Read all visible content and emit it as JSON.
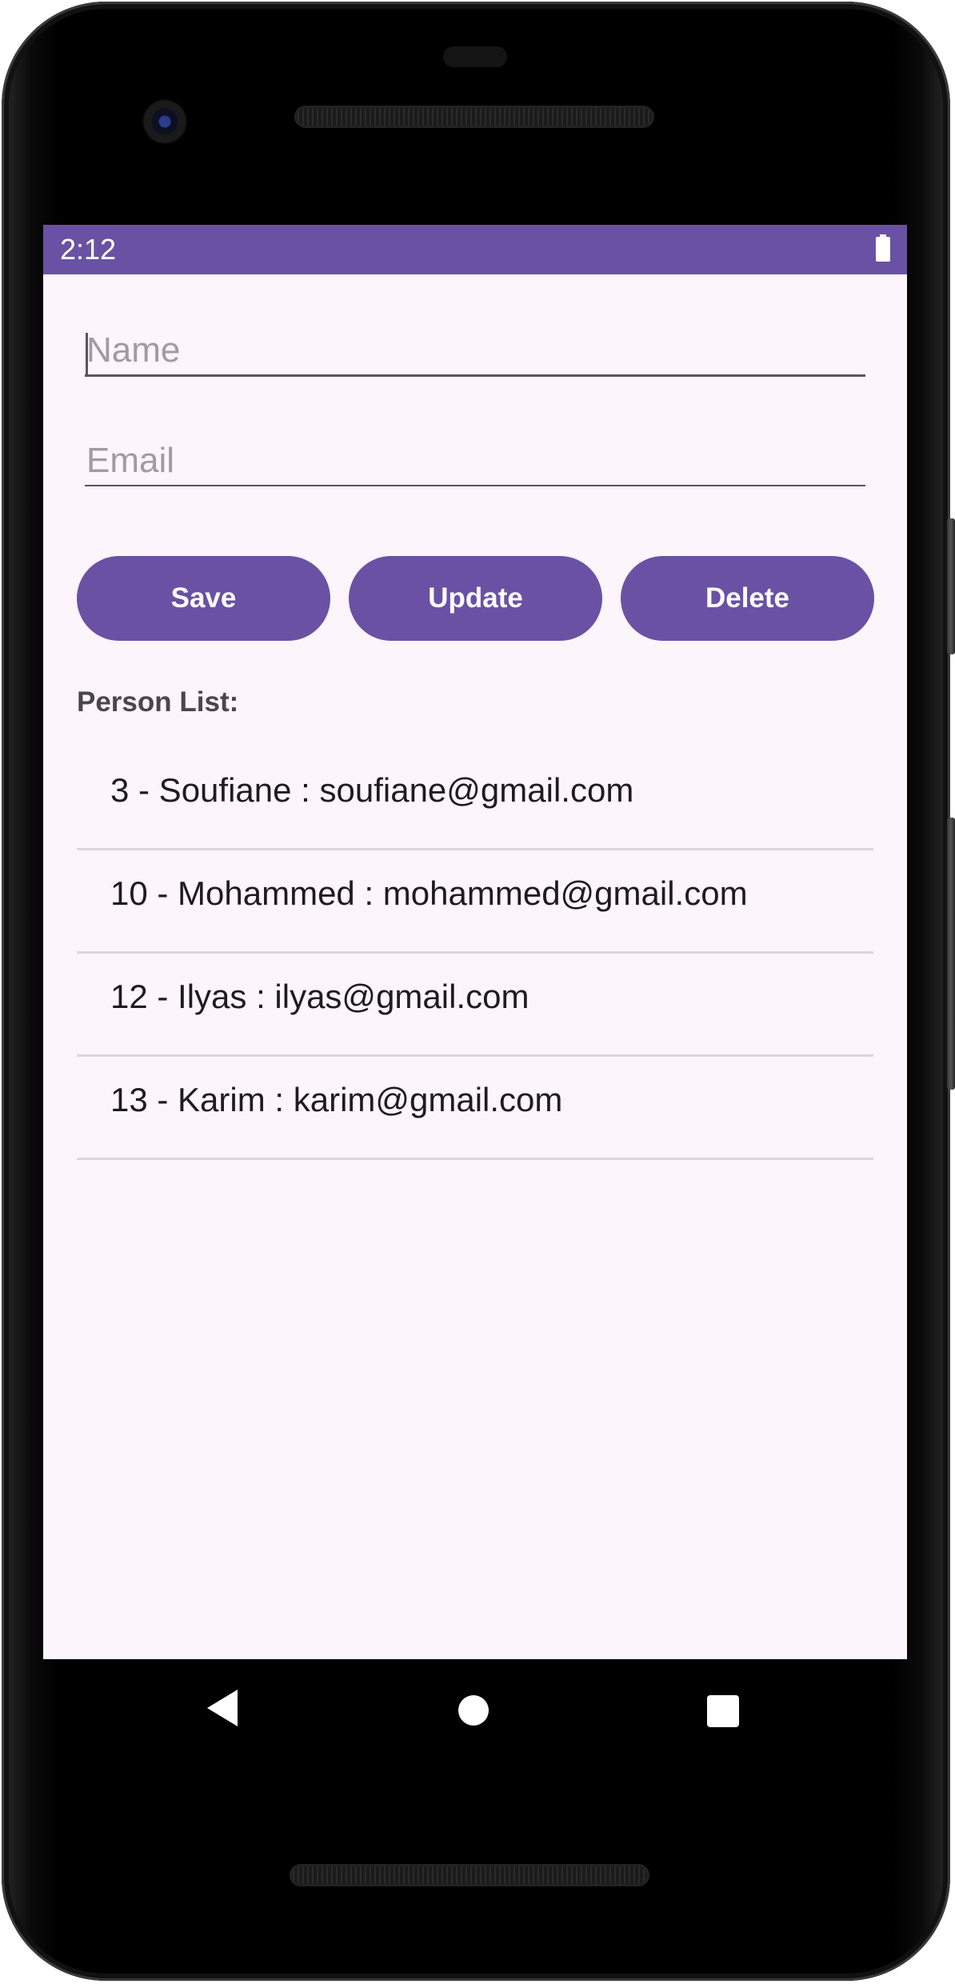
{
  "status_bar": {
    "time": "2:12",
    "battery_icon": "battery-full-icon"
  },
  "form": {
    "name_placeholder": "Name",
    "name_value": "",
    "email_placeholder": "Email",
    "email_value": ""
  },
  "buttons": {
    "save_label": "Save",
    "update_label": "Update",
    "delete_label": "Delete"
  },
  "list": {
    "title": "Person List:",
    "items": [
      "3 - Soufiane : soufiane@gmail.com",
      "10 - Mohammed : mohammed@gmail.com",
      "12 - Ilyas : ilyas@gmail.com",
      "13 - Karim : karim@gmail.com"
    ]
  },
  "nav_bar": {
    "back_icon": "back-triangle-icon",
    "home_icon": "home-circle-icon",
    "recents_icon": "recents-square-icon"
  },
  "colors": {
    "primary": "#6a51a3",
    "background": "#fcf5fc",
    "divider": "#dcd6dc",
    "text": "#201a22"
  }
}
